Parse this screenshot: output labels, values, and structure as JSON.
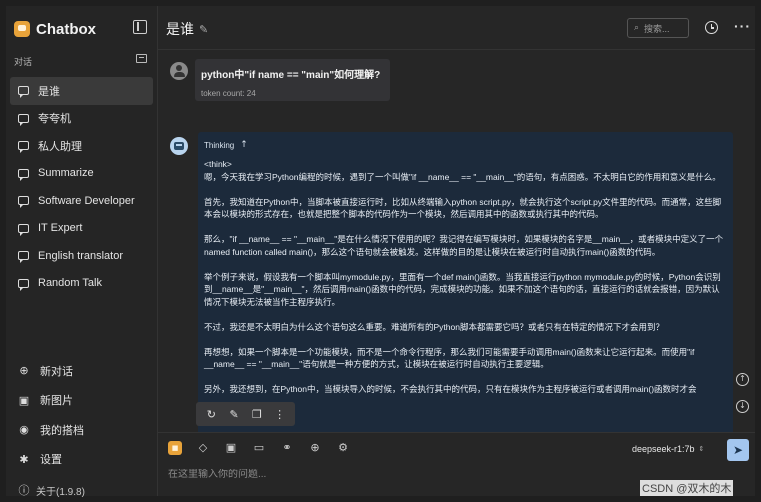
{
  "app": {
    "name": "Chatbox",
    "version_label": "关于(1.9.8)"
  },
  "sidebar": {
    "section_label": "对话",
    "conversations": [
      {
        "label": "是谁",
        "active": true
      },
      {
        "label": "夸夸机",
        "active": false
      },
      {
        "label": "私人助理",
        "active": false
      },
      {
        "label": "Summarize",
        "active": false
      },
      {
        "label": "Software Developer",
        "active": false
      },
      {
        "label": "IT Expert",
        "active": false
      },
      {
        "label": "English translator",
        "active": false
      },
      {
        "label": "Random Talk",
        "active": false
      }
    ],
    "menu": [
      {
        "label": "新对话",
        "icon": "plus-circle-icon",
        "glyph": "⊕"
      },
      {
        "label": "新图片",
        "icon": "image-add-icon",
        "glyph": "▣"
      },
      {
        "label": "我的搭档",
        "icon": "robot-icon",
        "glyph": "◉"
      },
      {
        "label": "设置",
        "icon": "gear-icon",
        "glyph": "✱"
      }
    ]
  },
  "header": {
    "title": "是谁",
    "search_placeholder": "搜索..."
  },
  "messages": {
    "user": {
      "text": "python中\"if name == \"main\"如何理解?",
      "token_count": "token count: 24"
    },
    "assistant": {
      "thinking_label": "Thinking",
      "paragraphs": [
        "<think>",
        "嗯，今天我在学习Python编程的时候，遇到了一个叫做\"if __name__ == \"__main__\"的语句，有点困惑。不太明白它的作用和意义是什么。",
        "首先，我知道在Python中，当脚本被直接运行时，比如从终端输入python script.py，就会执行这个script.py文件里的代码。而通常，这些脚本会以模块的形式存在，也就是把整个脚本的代码作为一个模块，然后调用其中的函数或执行其中的代码。",
        "那么，\"if __name__ == \"__main__\"是在什么情况下使用的呢？我记得在编写模块时，如果模块的名字是__main__，或者模块中定义了一个 named function called main()，那么这个语句就会被触发。这样做的目的是让模块在被运行时自动执行main()函数的代码。",
        "举个例子来说，假设我有一个脚本叫mymodule.py，里面有一个def main()函数。当我直接运行python mymodule.py的时候，Python会识别到__name__是\"__main__\"，然后调用main()函数中的代码，完成模块的功能。如果不加这个语句的话，直接运行的话就会报错，因为默认情况下模块无法被当作主程序执行。",
        "不过，我还是不太明白为什么这个语句这么重要。难道所有的Python脚本都需要它吗？或者只有在特定的情况下才会用到？",
        "再想想，如果一个脚本是一个功能模块，而不是一个命令行程序，那么我们可能需要手动调用main()函数来让它运行起来。而使用\"if __name__ == \"__main__\"语句就是一种方便的方式，让模块在被运行时自动执行主要逻辑。",
        "另外，我还想到，在Python中，当模块导入的时候，不会执行其中的代码，只有在模块作为主程序被运行或者调用main()函数时才会"
      ]
    }
  },
  "composer": {
    "model": "deepseek-r1:7b",
    "placeholder": "在这里输入你的问题..."
  },
  "watermark": "CSDN @双木的木"
}
